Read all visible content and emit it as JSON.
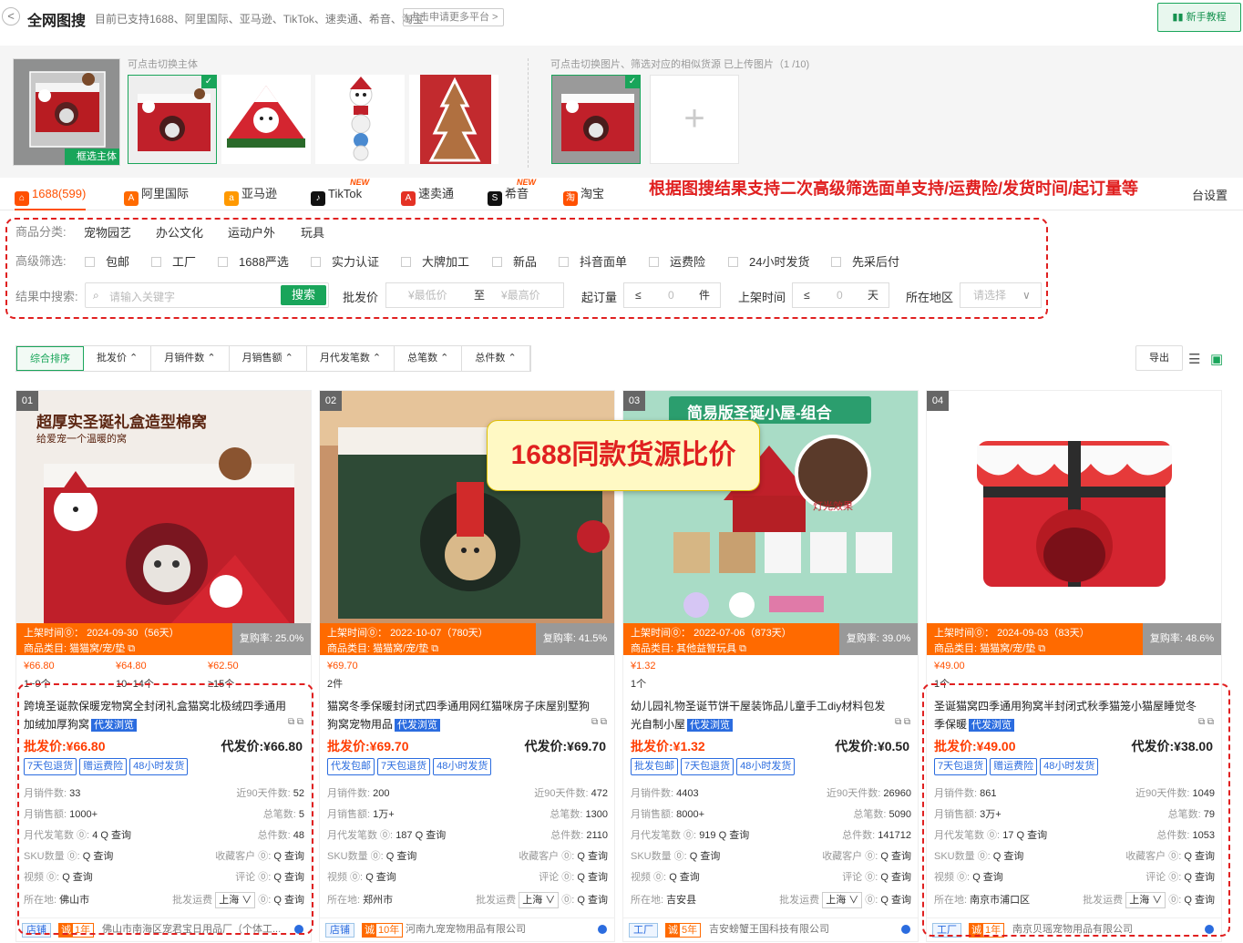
{
  "header": {
    "title": "全网图搜",
    "subtitle": "目前已支持1688、阿里国际、亚马逊、TikTok、速卖通、希音、淘宝",
    "apply_btn": "点击申请更多平台 >",
    "guide_btn": "新手教程",
    "back": "<"
  },
  "subjects": {
    "hint": "可点击切换主体",
    "frame_tag": "框选主体"
  },
  "uploads": {
    "hint": "可点击切换图片、筛选对应的相似货源 已上传图片（1 /10)",
    "add": "+"
  },
  "tabs": [
    {
      "label": "1688(599)",
      "icon": "1688",
      "color": "#ff5000"
    },
    {
      "label": "阿里国际",
      "icon": "A",
      "color": "#ff6a00"
    },
    {
      "label": "亚马逊",
      "icon": "a",
      "color": "#ff9900"
    },
    {
      "label": "TikTok",
      "icon": "♪",
      "color": "#111111",
      "new": "NEW"
    },
    {
      "label": "速卖通",
      "icon": "A",
      "color": "#e43225"
    },
    {
      "label": "希音",
      "icon": "S",
      "color": "#111111",
      "new": "NEW"
    },
    {
      "label": "淘宝",
      "icon": "淘",
      "color": "#ff5000"
    }
  ],
  "annotation": "根据图搜结果支持二次高级筛选面单支持/运费险/发货时间/起订量等",
  "setting": "台设置",
  "filters": {
    "category_label": "商品分类:",
    "categories": [
      "宠物园艺",
      "办公文化",
      "运动户外",
      "玩具"
    ],
    "adv_label": "高级筛选:",
    "checks": [
      "包邮",
      "工厂",
      "1688严选",
      "实力认证",
      "大牌加工",
      "新品",
      "抖音面单",
      "运费险",
      "24小时发货",
      "先采后付"
    ],
    "search_label": "结果中搜索:",
    "search_ph": "请输入关键字",
    "search_btn": "搜索",
    "price_label": "批发价",
    "min_ph": "¥最低价",
    "to": "至",
    "max_ph": "¥最高价",
    "moq_label": "起订量",
    "le": "≤",
    "zero": "0",
    "unit": "件",
    "time_label": "上架时间",
    "day": "天",
    "region_label": "所在地区",
    "region_ph": "请选择"
  },
  "sort": [
    "综合排序",
    "批发价 ⌃",
    "月销件数 ⌃",
    "月销售额 ⌃",
    "月代发笔数 ⌃",
    "总笔数 ⌃",
    "总件数 ⌃"
  ],
  "export": "导出",
  "overlay": "1688同款货源比价",
  "labels": {
    "list_time": "上架时间⓪：",
    "cat": "商品类目:",
    "repurchase": "复购率:",
    "wholesale": "批发价:",
    "dropship": "代发价:",
    "dist_tag": "代发浏览",
    "m_qty": "月销件数:",
    "m_amt": "月销售额:",
    "m_ds": "月代发笔数 ⓪:",
    "sku": "SKU数量 ⓪:",
    "video": "视频 ⓪:",
    "region": "所在地:",
    "d90": "近90天件数:",
    "total_orders": "总笔数:",
    "total_qty": "总件数:",
    "fav": "收藏客户 ⓪:",
    "review": "评论 ⓪:",
    "ship": "批发运费",
    "query": "Q 查询",
    "ship_sel": "上海 ∨"
  },
  "products": [
    {
      "idx": "01",
      "img_title": "超厚实圣诞礼盒造型棉窝",
      "img_sub": "给爱宠一个温暖的窝",
      "list_time": "2024-09-30（56天）",
      "cat": "猫猫窝/宠/垫 ⧉",
      "repurchase": "25.0%",
      "tiers": [
        {
          "p": "¥66.80",
          "q": "1~9个"
        },
        {
          "p": "¥64.80",
          "q": "10~14个"
        },
        {
          "p": "¥62.50",
          "q": "≥15个"
        }
      ],
      "title": "跨境圣诞款保暖宠物窝全封闭礼盒猫窝北极绒四季通用加绒加厚狗窝",
      "wprice": "¥66.80",
      "dprice": "¥66.80",
      "badges": [
        "7天包退货",
        "赠运费险",
        "48小时发货"
      ],
      "m_qty": "33",
      "m_amt": "1000+",
      "m_ds": "4",
      "d90": "52",
      "orders": "5",
      "total": "48",
      "location": "佛山市",
      "type": "店铺",
      "years": "1年",
      "company": "佛山市南海区宠君宝日用品厂（个体工..."
    },
    {
      "idx": "02",
      "img_title": "",
      "img_sub": "",
      "list_time": "2022-10-07（780天）",
      "cat": "猫猫窝/宠/垫 ⧉",
      "repurchase": "41.5%",
      "tiers": [
        {
          "p": "¥69.70",
          "q": "2件"
        }
      ],
      "title": "猫窝冬季保暖封闭式四季通用网红猫咪房子床屋别墅狗狗窝宠物用品",
      "wprice": "¥69.70",
      "dprice": "¥69.70",
      "badges": [
        "代发包邮",
        "7天包退货",
        "48小时发货"
      ],
      "m_qty": "200",
      "m_amt": "1万+",
      "m_ds": "187",
      "d90": "472",
      "orders": "1300",
      "total": "2110",
      "location": "郑州市",
      "type": "店铺",
      "years": "10年",
      "company": "河南九宠宠物用品有限公司"
    },
    {
      "idx": "03",
      "img_title": "简易版圣诞小屋-组合",
      "img_sub": "灯光效果",
      "list_time": "2022-07-06（873天）",
      "cat": "其他益智玩具 ⧉",
      "repurchase": "39.0%",
      "tiers": [
        {
          "p": "¥1.32",
          "q": "1个"
        }
      ],
      "title": "幼儿园礼物圣诞节饼干屋装饰品儿童手工diy材料包发光自制小屋",
      "wprice": "¥1.32",
      "dprice": "¥0.50",
      "badges": [
        "批发包邮",
        "7天包退货",
        "48小时发货"
      ],
      "m_qty": "4403",
      "m_amt": "8000+",
      "m_ds": "919",
      "d90": "26960",
      "orders": "5090",
      "total": "141712",
      "location": "吉安县",
      "type": "工厂",
      "years": "5年",
      "company": "吉安螃蟹王国科技有限公司"
    },
    {
      "idx": "04",
      "img_title": "",
      "img_sub": "",
      "list_time": "2024-09-03（83天）",
      "cat": "猫猫窝/宠/垫 ⧉",
      "repurchase": "48.6%",
      "tiers": [
        {
          "p": "¥49.00",
          "q": "1个"
        }
      ],
      "title": "圣诞猫窝四季通用狗窝半封闭式秋季猫笼小猫屋睡觉冬季保暖",
      "wprice": "¥49.00",
      "dprice": "¥38.00",
      "badges": [
        "7天包退货",
        "赠运费险",
        "48小时发货"
      ],
      "m_qty": "861",
      "m_amt": "3万+",
      "m_ds": "17",
      "d90": "1049",
      "orders": "79",
      "total": "1053",
      "location": "南京市浦口区",
      "type": "工厂",
      "years": "1年",
      "company": "南京贝瑶宠物用品有限公司"
    }
  ],
  "colors": {
    "accent": "#ff5000",
    "green": "#19a55a",
    "blue": "#2b6cdf",
    "annot": "#e02020"
  }
}
